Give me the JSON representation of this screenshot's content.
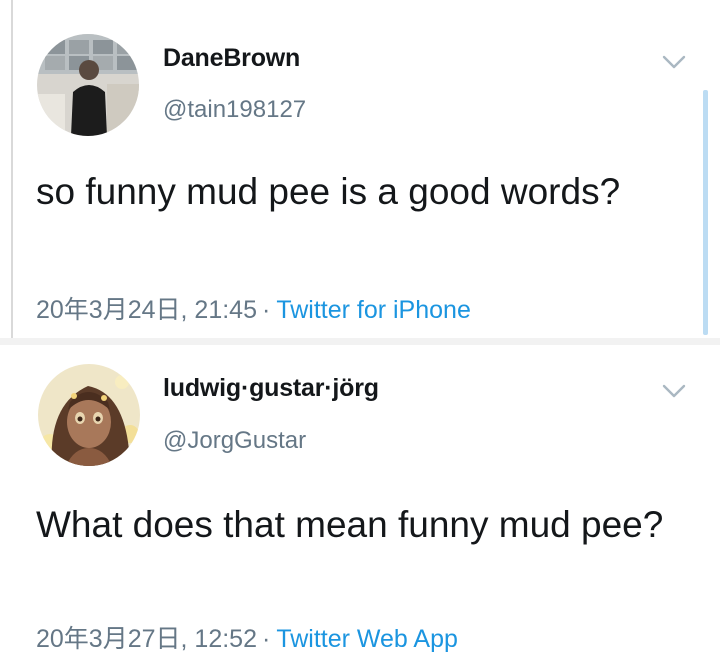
{
  "tweets": [
    {
      "display_name": "DaneBrown",
      "handle": "@tain198127",
      "text": "so funny mud pee is a good words?",
      "timestamp": "20年3月24日, 21:45",
      "separator": "·",
      "source": "Twitter for iPhone",
      "avatar": "profile-photo-person"
    },
    {
      "display_name": "ludwig·gustar·jörg",
      "handle": "@JorgGustar",
      "text": "What does that mean funny mud pee?",
      "timestamp": "20年3月27日, 12:52",
      "separator": "·",
      "source": "Twitter Web App",
      "avatar": "anime-girl-illustration"
    }
  ],
  "colors": {
    "text": "#14171a",
    "secondary": "#657786",
    "link": "#1b95e0"
  }
}
